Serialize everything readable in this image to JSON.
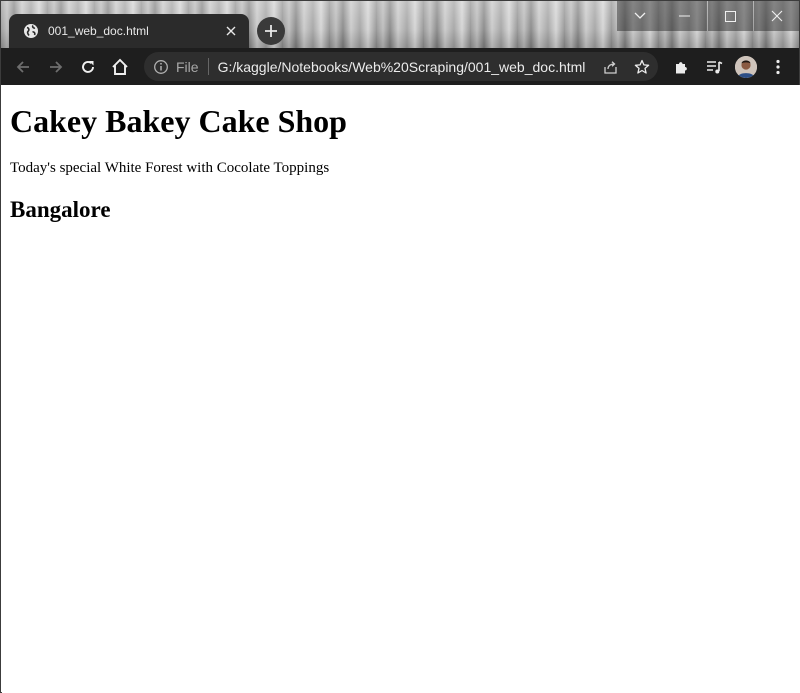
{
  "browser": {
    "tab": {
      "title": "001_web_doc.html",
      "favicon": "globe-icon"
    },
    "new_tab_icon": "plus-icon",
    "window_controls": [
      "chevron-down-icon",
      "minimize-icon",
      "maximize-icon",
      "close-icon"
    ],
    "toolbar": {
      "back_icon": "arrow-left-icon",
      "forward_icon": "arrow-right-icon",
      "reload_icon": "reload-icon",
      "home_icon": "home-icon",
      "address": {
        "info_icon": "info-icon",
        "scheme": "File",
        "url": "G:/kaggle/Notebooks/Web%20Scraping/001_web_doc.html"
      },
      "share_icon": "share-icon",
      "bookmark_icon": "star-icon",
      "extensions_icon": "puzzle-icon",
      "media_icon": "media-queue-icon",
      "avatar": "profile-avatar",
      "menu_icon": "kebab-menu-icon"
    },
    "colors": {
      "tab_bg": "#2b2b2b",
      "toolbar_bg": "#1e1e1e",
      "omnibox_bg": "#2e2e2e"
    }
  },
  "document": {
    "heading": "Cakey Bakey Cake Shop",
    "paragraph": "Today's special White Forest with Cocolate Toppings",
    "subheading": "Bangalore"
  }
}
